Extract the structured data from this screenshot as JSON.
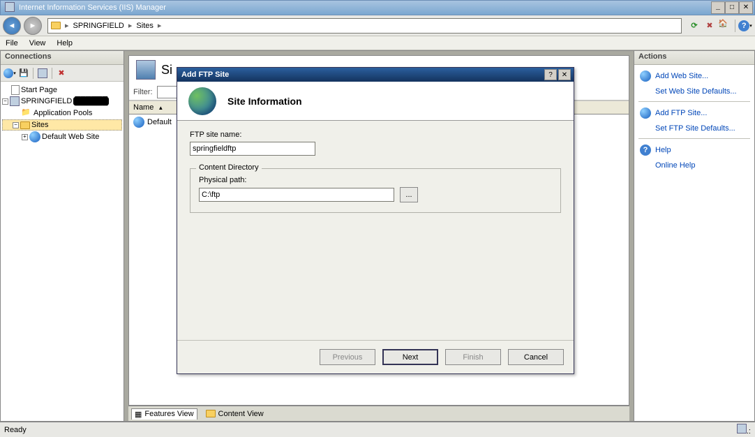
{
  "window": {
    "title": "Internet Information Services (IIS) Manager"
  },
  "breadcrumb": {
    "item1": "SPRINGFIELD",
    "item2": "Sites"
  },
  "menu": {
    "file": "File",
    "view": "View",
    "help": "Help"
  },
  "panels": {
    "connections": "Connections",
    "actions": "Actions"
  },
  "tree": {
    "start_page": "Start Page",
    "server": "SPRINGFIELD",
    "app_pools": "Application Pools",
    "sites": "Sites",
    "default_site": "Default Web Site"
  },
  "center": {
    "heading_prefix": "Si",
    "filter_label": "Filter:",
    "col_name": "Name",
    "row_default": "Default"
  },
  "view_tabs": {
    "features": "Features View",
    "content": "Content View"
  },
  "actions": {
    "add_web": "Add Web Site...",
    "web_defaults": "Set Web Site Defaults...",
    "add_ftp": "Add FTP Site...",
    "ftp_defaults": "Set FTP Site Defaults...",
    "help": "Help",
    "online_help": "Online Help"
  },
  "dialog": {
    "title": "Add FTP Site",
    "header": "Site Information",
    "ftp_name_label": "FTP site name:",
    "ftp_name_value": "springfieldftp",
    "fieldset": "Content Directory",
    "path_label": "Physical path:",
    "path_value": "C:\\ftp",
    "browse": "...",
    "previous": "Previous",
    "next": "Next",
    "finish": "Finish",
    "cancel": "Cancel"
  },
  "status": {
    "ready": "Ready"
  }
}
